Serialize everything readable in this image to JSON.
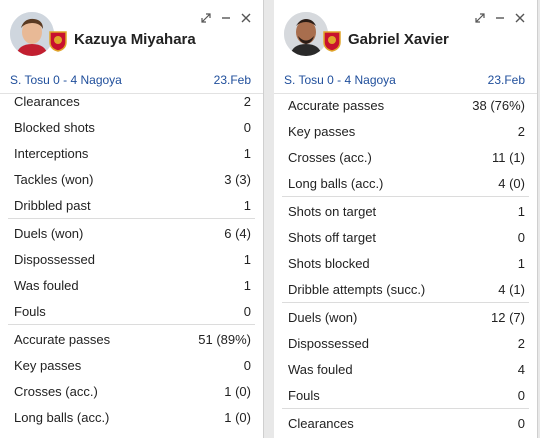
{
  "players": [
    {
      "name": "Kazuya Miyahara",
      "match": "S. Tosu 0 - 4 Nagoya",
      "date": "23.Feb",
      "rows_top": [
        {
          "label": "Clearances",
          "value": "2"
        },
        {
          "label": "Blocked shots",
          "value": "0"
        },
        {
          "label": "Interceptions",
          "value": "1"
        },
        {
          "label": "Tackles (won)",
          "value": "3 (3)"
        },
        {
          "label": "Dribbled past",
          "value": "1"
        }
      ],
      "rows_mid": [
        {
          "label": "Duels (won)",
          "value": "6 (4)"
        },
        {
          "label": "Dispossessed",
          "value": "1"
        },
        {
          "label": "Was fouled",
          "value": "1"
        },
        {
          "label": "Fouls",
          "value": "0"
        }
      ],
      "rows_bot": [
        {
          "label": "Accurate passes",
          "value": "51 (89%)"
        },
        {
          "label": "Key passes",
          "value": "0"
        },
        {
          "label": "Crosses (acc.)",
          "value": "1 (0)"
        },
        {
          "label": "Long balls (acc.)",
          "value": "1 (0)"
        }
      ]
    },
    {
      "name": "Gabriel Xavier",
      "match": "S. Tosu 0 - 4 Nagoya",
      "date": "23.Feb",
      "rows_top": [
        {
          "label": "Accurate passes",
          "value": "38 (76%)"
        },
        {
          "label": "Key passes",
          "value": "2"
        },
        {
          "label": "Crosses (acc.)",
          "value": "11 (1)"
        },
        {
          "label": "Long balls (acc.)",
          "value": "4 (0)"
        }
      ],
      "rows_mid": [
        {
          "label": "Shots on target",
          "value": "1"
        },
        {
          "label": "Shots off target",
          "value": "0"
        },
        {
          "label": "Shots blocked",
          "value": "1"
        },
        {
          "label": "Dribble attempts (succ.)",
          "value": "4 (1)"
        }
      ],
      "rows_bot": [
        {
          "label": "Duels (won)",
          "value": "12 (7)"
        },
        {
          "label": "Dispossessed",
          "value": "2"
        },
        {
          "label": "Was fouled",
          "value": "4"
        },
        {
          "label": "Fouls",
          "value": "0"
        },
        {
          "label": "Clearances",
          "value": "0"
        }
      ]
    }
  ],
  "colors": {
    "link": "#1f4e9b",
    "badge_red": "#c8102e",
    "badge_gold": "#e0a52a"
  }
}
